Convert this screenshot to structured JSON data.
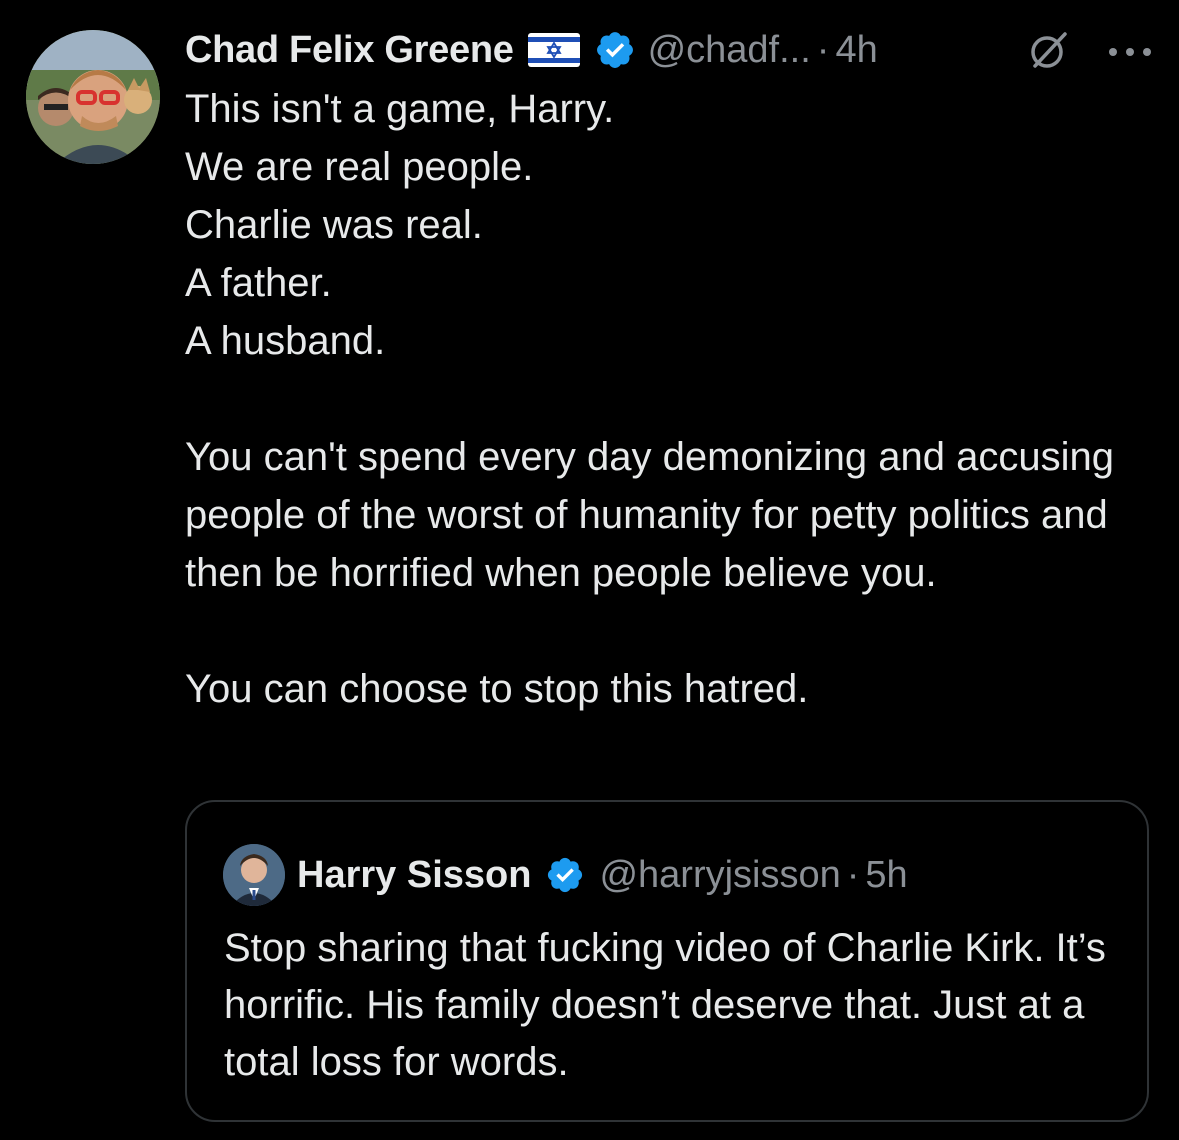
{
  "tweet": {
    "author": {
      "display_name": "Chad Felix Greene",
      "flag_icon": "israel-flag-icon",
      "verified_icon": "verified-badge-icon",
      "handle": "@chadf...",
      "separator": "·",
      "time": "4h"
    },
    "actions": {
      "grok_icon": "grok-icon",
      "more_icon": "more-options-icon"
    },
    "text": "This isn't a game, Harry.\nWe are real people.\nCharlie was real.\nA father.\nA husband.\n\nYou can't spend every day demonizing and accusing people of the worst of humanity for petty politics and then be horrified when people believe you.\n\nYou can choose to stop this hatred."
  },
  "quoted_tweet": {
    "author": {
      "display_name": "Harry Sisson",
      "verified_icon": "verified-badge-icon",
      "handle": "@harryjsisson",
      "separator": "·",
      "time": "5h"
    },
    "text": "Stop sharing that fucking video of Charlie Kirk. It’s horrific. His family doesn’t deserve that. Just at a total loss for words."
  },
  "colors": {
    "background": "#000000",
    "primary_text": "#e7e9ea",
    "secondary_text": "#8b9096",
    "verified_blue": "#1d9bf0",
    "quote_border": "#2f3336"
  }
}
